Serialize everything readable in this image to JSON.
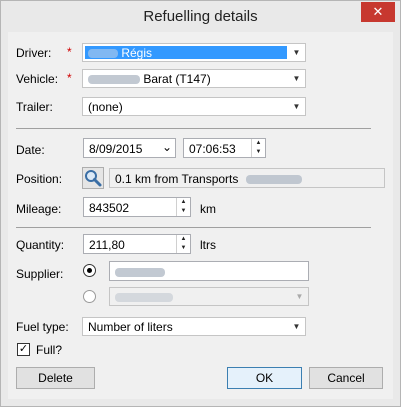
{
  "window": {
    "title": "Refuelling details",
    "close_symbol": "✕"
  },
  "form": {
    "driver": {
      "label": "Driver:",
      "required_mark": "*",
      "value": "Régis",
      "arrow": "▼"
    },
    "vehicle": {
      "label": "Vehicle:",
      "required_mark": "*",
      "value": "Barat (T147)",
      "arrow": "▼"
    },
    "trailer": {
      "label": "Trailer:",
      "value": "(none)",
      "arrow": "▼"
    },
    "date": {
      "label": "Date:",
      "date_value": "8/09/2015",
      "time_value": "07:06:53",
      "arrow": "⌄"
    },
    "position": {
      "label": "Position:",
      "value": "0.1 km from Transports"
    },
    "mileage": {
      "label": "Mileage:",
      "value": "843502",
      "unit": "km"
    },
    "quantity": {
      "label": "Quantity:",
      "value": "211,80",
      "unit": "ltrs"
    },
    "supplier": {
      "label": "Supplier:",
      "selected_option": 1,
      "arrow": "▼"
    },
    "fuel_type": {
      "label": "Fuel type:",
      "value": "Number of liters",
      "arrow": "▼"
    },
    "full": {
      "label": "Full?",
      "checked": true,
      "check_mark": "✓"
    }
  },
  "spin": {
    "up": "▲",
    "down": "▼"
  },
  "buttons": {
    "delete": "Delete",
    "ok": "OK",
    "cancel": "Cancel"
  },
  "icons": {
    "position_button": "search-icon"
  }
}
